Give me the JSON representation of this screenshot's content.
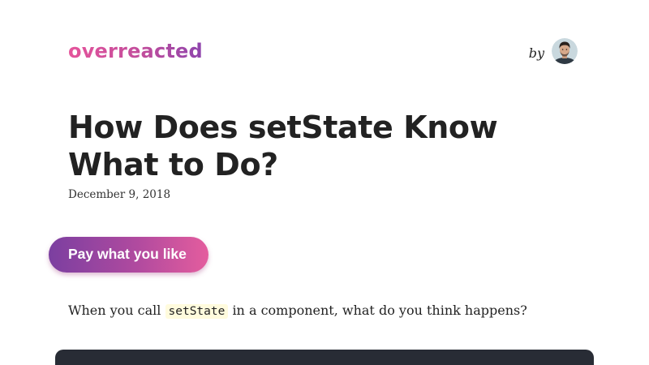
{
  "header": {
    "logo_text": "overreacted",
    "by_text": "by"
  },
  "article": {
    "title": "How Does setState Know What to Do?",
    "date": "December 9, 2018",
    "pay_button_label": "Pay what you like",
    "intro": {
      "before": "When you call",
      "code": "setState",
      "after": "in a component, what do you think happens?"
    }
  },
  "colors": {
    "logo_gradient": [
      "#e5549b",
      "#8e44ad"
    ],
    "button_gradient": [
      "#7b3fa0",
      "#e45d9e"
    ],
    "text": "#222222",
    "inline_code_bg": "#fffbdd",
    "code_block_bg": "#282c35"
  },
  "icons": {
    "avatar": "author-avatar"
  }
}
